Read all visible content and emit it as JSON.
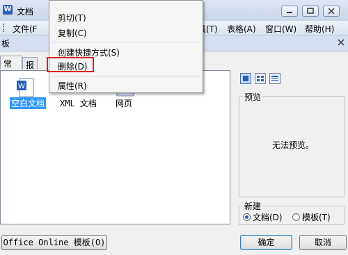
{
  "window": {
    "title": "文档",
    "icon": "word-app-icon"
  },
  "menubar": {
    "items": [
      "文件(F",
      "具(T)",
      "表格(A)",
      "窗口(W)",
      "帮助(H)"
    ]
  },
  "dialog": {
    "caption": "板",
    "tabs": [
      "常用",
      "报"
    ],
    "templates": [
      {
        "label": "空白文档",
        "icon": "word-doc-icon",
        "selected": true
      },
      {
        "label": "XML 文档",
        "icon": "xml-doc-icon",
        "selected": false
      },
      {
        "label": "网页",
        "icon": "web-page-icon",
        "selected": false
      }
    ],
    "preview": {
      "label": "预览",
      "text": "无法预览。"
    },
    "new_group": {
      "label": "新建",
      "options": [
        {
          "label": "文档(D)",
          "selected": true
        },
        {
          "label": "模板(T)",
          "selected": false
        }
      ]
    },
    "buttons": {
      "office_online": "Office Online 模板(O)",
      "ok": "确定",
      "cancel": "取消"
    }
  },
  "context_menu": {
    "items": [
      "剪切(T)",
      "复制(C)",
      "创建快捷方式(S)",
      "删除(D)",
      "属性(R)"
    ],
    "highlighted": "删除(D)",
    "highlight_color": "#e02020"
  }
}
